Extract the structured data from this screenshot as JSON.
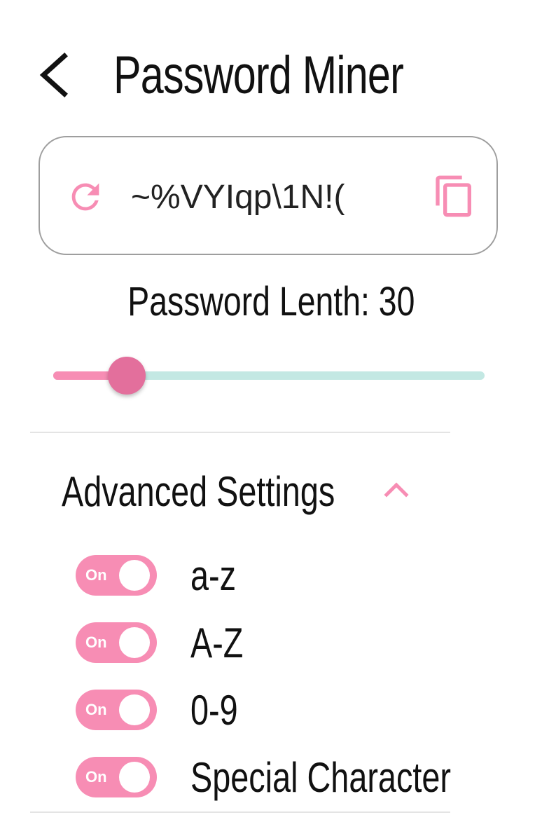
{
  "header": {
    "title": "Password Miner",
    "back_icon": "chevron-left-icon"
  },
  "password": {
    "value": "~%VYIqp\\1N!(",
    "refresh_icon": "refresh-icon",
    "copy_icon": "copy-icon"
  },
  "length": {
    "label": "Password Lenth: 30",
    "value": 30,
    "slider_fraction": 0.17
  },
  "advanced": {
    "title": "Advanced Settings",
    "expanded": true,
    "chevron_icon": "chevron-up-icon",
    "options": [
      {
        "toggle_text": "On",
        "label": "a-z",
        "enabled": true
      },
      {
        "toggle_text": "On",
        "label": "A-Z",
        "enabled": true
      },
      {
        "toggle_text": "On",
        "label": "0-9",
        "enabled": true
      },
      {
        "toggle_text": "On",
        "label": "Special Character",
        "enabled": true
      }
    ]
  },
  "colors": {
    "accent": "#f78db4",
    "slider_thumb": "#e36f9c",
    "slider_track": "#c3e8e3",
    "border": "#9e9e9e"
  }
}
